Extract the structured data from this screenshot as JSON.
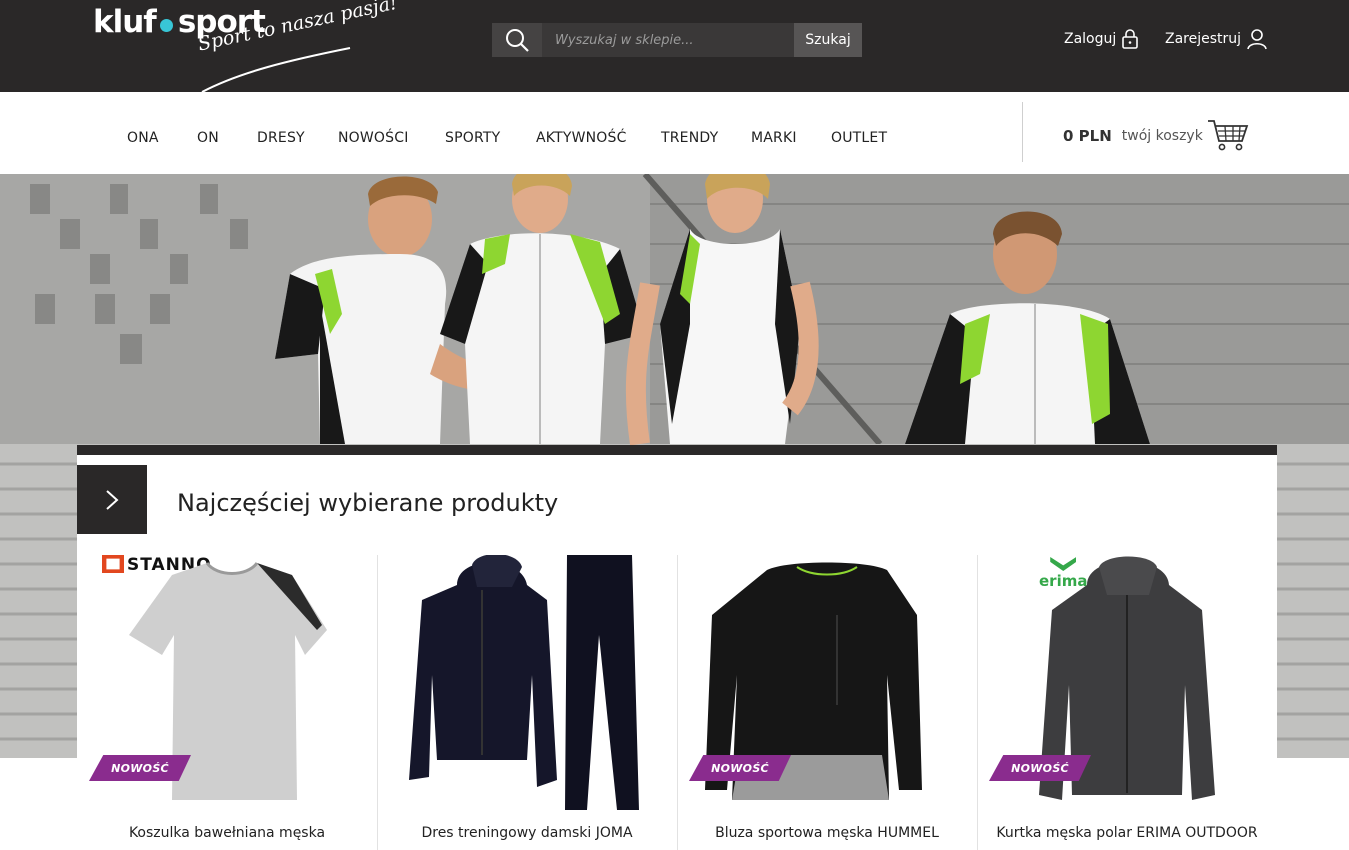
{
  "header": {
    "logo": {
      "main_part1": "kluf",
      "main_part2": "sport",
      "tagline": "Sport to nasza pasja!",
      "dot_color": "#38c6d6"
    },
    "search": {
      "placeholder": "Wyszukaj w sklepie...",
      "button_label": "Szukaj",
      "icon": "search-icon"
    },
    "account": {
      "login_label": "Zaloguj",
      "login_icon": "lock-icon",
      "register_label": "Zarejestruj",
      "register_icon": "user-icon"
    }
  },
  "nav": {
    "items": [
      {
        "label": "ONA"
      },
      {
        "label": "ON"
      },
      {
        "label": "DRESY"
      },
      {
        "label": "NOWOŚCI"
      },
      {
        "label": "SPORTY"
      },
      {
        "label": "AKTYWNOŚĆ"
      },
      {
        "label": "TRENDY"
      },
      {
        "label": "MARKI"
      },
      {
        "label": "OUTLET"
      }
    ],
    "cart": {
      "amount": "0 PLN",
      "label": "twój koszyk",
      "icon": "cart-icon"
    }
  },
  "hero": {
    "image": "athletes-in-sportswear-on-stadium-stairs"
  },
  "products_section": {
    "title": "Najczęściej wybierane produkty",
    "arrow_icon": "chevron-right-icon",
    "products": [
      {
        "name": "Koszulka bawełniana męska",
        "badge": "NOWOŚĆ",
        "brand": "STANNO",
        "image": "grey-t-shirt"
      },
      {
        "name": "Dres treningowy damski JOMA",
        "badge": "",
        "brand": "",
        "image": "black-tracksuit"
      },
      {
        "name": "Bluza sportowa męska HUMMEL",
        "badge": "NOWOŚĆ",
        "brand": "",
        "image": "black-sweatshirt"
      },
      {
        "name": "Kurtka męska polar ERIMA OUTDOOR",
        "badge": "NOWOŚĆ",
        "brand": "erima",
        "image": "grey-hooded-jacket"
      }
    ]
  },
  "colors": {
    "header_bg": "#2a2828",
    "badge": "#8a2c8e",
    "accent_green": "#8ed631"
  }
}
